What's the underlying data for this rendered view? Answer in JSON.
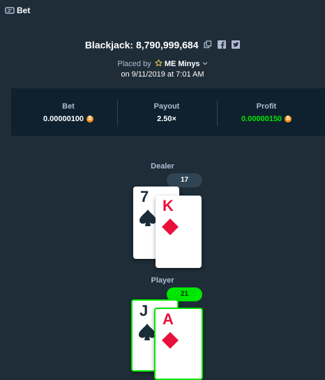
{
  "header": {
    "title": "Bet",
    "icon": "bet-ticket-icon"
  },
  "bet": {
    "title": "Blackjack: 8,790,999,684",
    "placed_by_prefix": "Placed by",
    "user_badge": "ME",
    "user_name": "Minys",
    "date": "on 9/11/2019 at 7:01 AM"
  },
  "stats": {
    "bet_label": "Bet",
    "bet_value": "0.00000100",
    "payout_label": "Payout",
    "payout_value": "2.50×",
    "profit_label": "Profit",
    "profit_value": "0.00000150",
    "currency_icon": "bitcoin-icon"
  },
  "dealer": {
    "label": "Dealer",
    "score": "17",
    "cards": [
      {
        "rank": "7",
        "suit": "spades"
      },
      {
        "rank": "K",
        "suit": "diamonds"
      }
    ]
  },
  "player": {
    "label": "Player",
    "score": "21",
    "cards": [
      {
        "rank": "J",
        "suit": "spades"
      },
      {
        "rank": "A",
        "suit": "diamonds"
      }
    ]
  },
  "colors": {
    "background": "#1f2d38",
    "panel": "#0f212e",
    "win_green": "#00e701",
    "red_suit": "#e9113c",
    "black_suit": "#1a2c38",
    "coin": "#f7931a"
  }
}
